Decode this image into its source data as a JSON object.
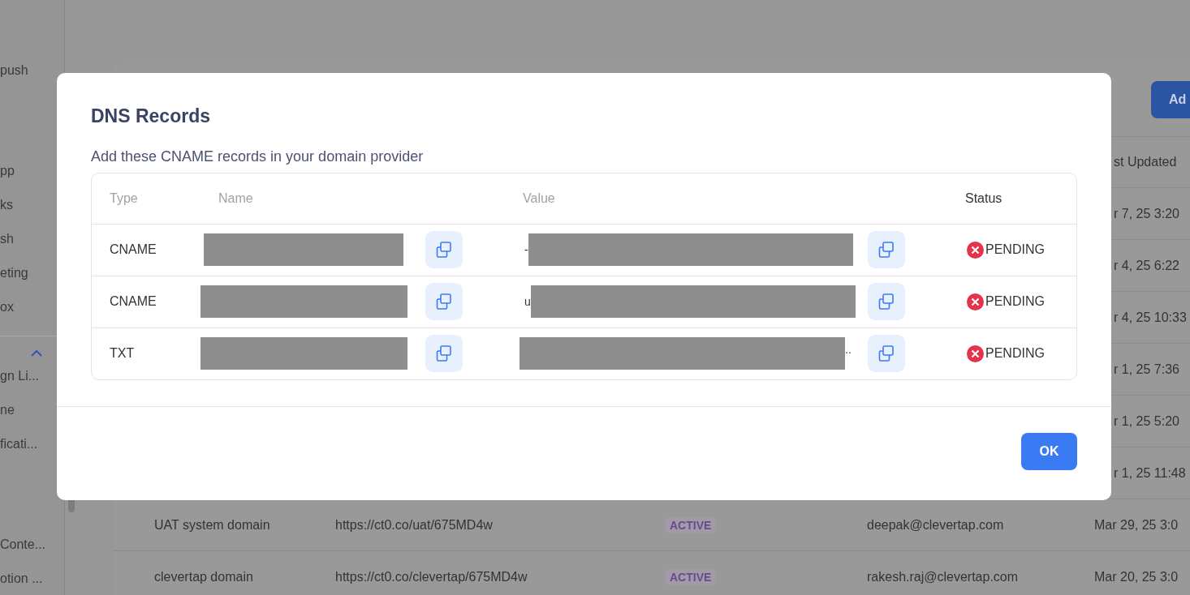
{
  "background": {
    "sidebar": {
      "items": [
        {
          "label": "push"
        },
        {
          "label": "pp"
        },
        {
          "label": "ks"
        },
        {
          "label": "sh"
        },
        {
          "label": "eting"
        },
        {
          "label": "ox"
        }
      ],
      "group": {
        "expanded": true,
        "items": [
          {
            "label": "gn Li..."
          },
          {
            "label": "ne"
          },
          {
            "label": "ficati..."
          }
        ]
      },
      "more_items": [
        {
          "label": "Conte..."
        },
        {
          "label": "otion ..."
        }
      ]
    },
    "table": {
      "add_button": "Ad",
      "columns": [
        "st Updated"
      ],
      "rows": [
        {
          "updated": "r 7, 25 3:20"
        },
        {
          "updated": "r 4, 25 6:22"
        },
        {
          "updated": "r 4, 25 10:33"
        },
        {
          "updated": "r 1, 25 7:36"
        },
        {
          "updated": "r 1, 25 5:20"
        },
        {
          "updated": "r 1, 25 11:48"
        },
        {
          "name": "UAT system domain",
          "url": "https://ct0.co/uat/675MD4w",
          "status": "ACTIVE",
          "owner": "deepak@clevertap.com",
          "updated": "Mar 29, 25 3:0"
        },
        {
          "name": "clevertap domain",
          "url": "https://ct0.co/clevertap/675MD4w",
          "status": "ACTIVE",
          "owner": "rakesh.raj@clevertap.com",
          "updated": "Mar 20, 25 3:0"
        }
      ]
    }
  },
  "dialog": {
    "title": "DNS Records",
    "subtitle": "Add these CNAME records in your domain provider",
    "columns": [
      "Type",
      "Name",
      "Value",
      "Status"
    ],
    "records": [
      {
        "type": "CNAME",
        "value_lead": "-",
        "status": "PENDING"
      },
      {
        "type": "CNAME",
        "value_lead": "u",
        "status": "PENDING"
      },
      {
        "type": "TXT",
        "value_tail": "..",
        "status": "PENDING"
      }
    ],
    "ok_button": "OK"
  }
}
